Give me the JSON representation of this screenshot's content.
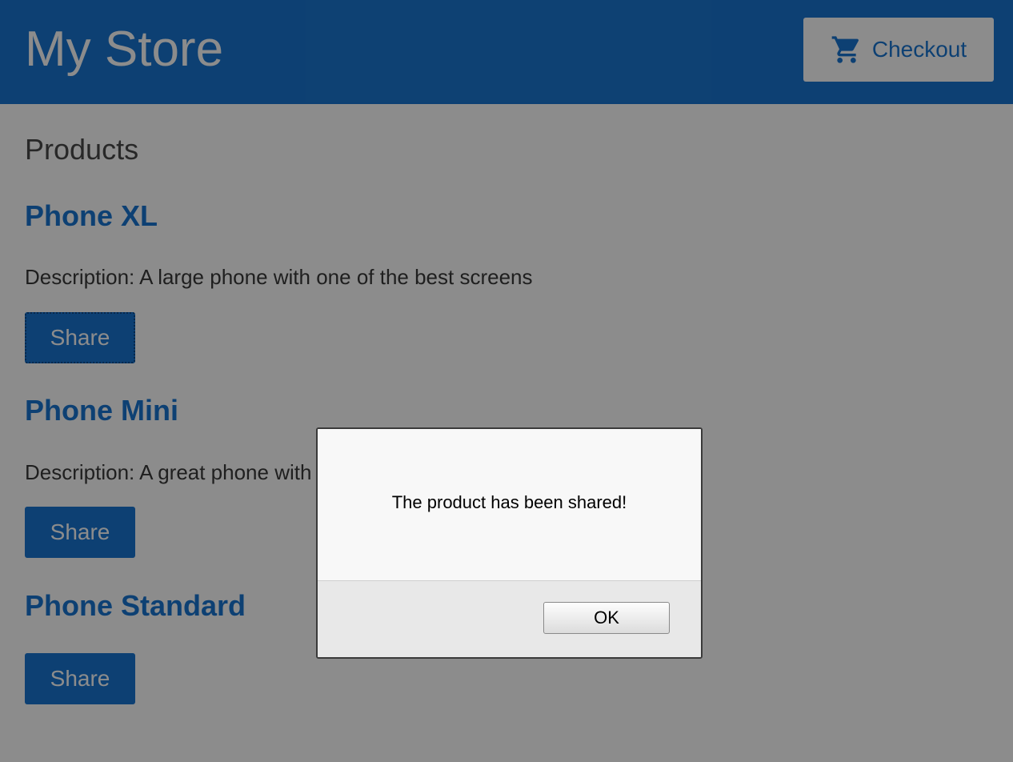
{
  "header": {
    "title": "My Store",
    "checkout_label": "Checkout",
    "checkout_icon": "shopping-cart-icon"
  },
  "main": {
    "heading": "Products",
    "products": [
      {
        "name": "Phone XL",
        "description": "Description: A large phone with one of the best screens",
        "share_label": "Share"
      },
      {
        "name": "Phone Mini",
        "description": "Description: A great phone with one of the best cameras",
        "share_label": "Share"
      },
      {
        "name": "Phone Standard",
        "description": "",
        "share_label": "Share"
      }
    ]
  },
  "dialog": {
    "message": "The product has been shared!",
    "ok_label": "OK"
  },
  "colors": {
    "primary": "#1976d2",
    "overlay": "rgba(0,0,0,0.45)"
  }
}
